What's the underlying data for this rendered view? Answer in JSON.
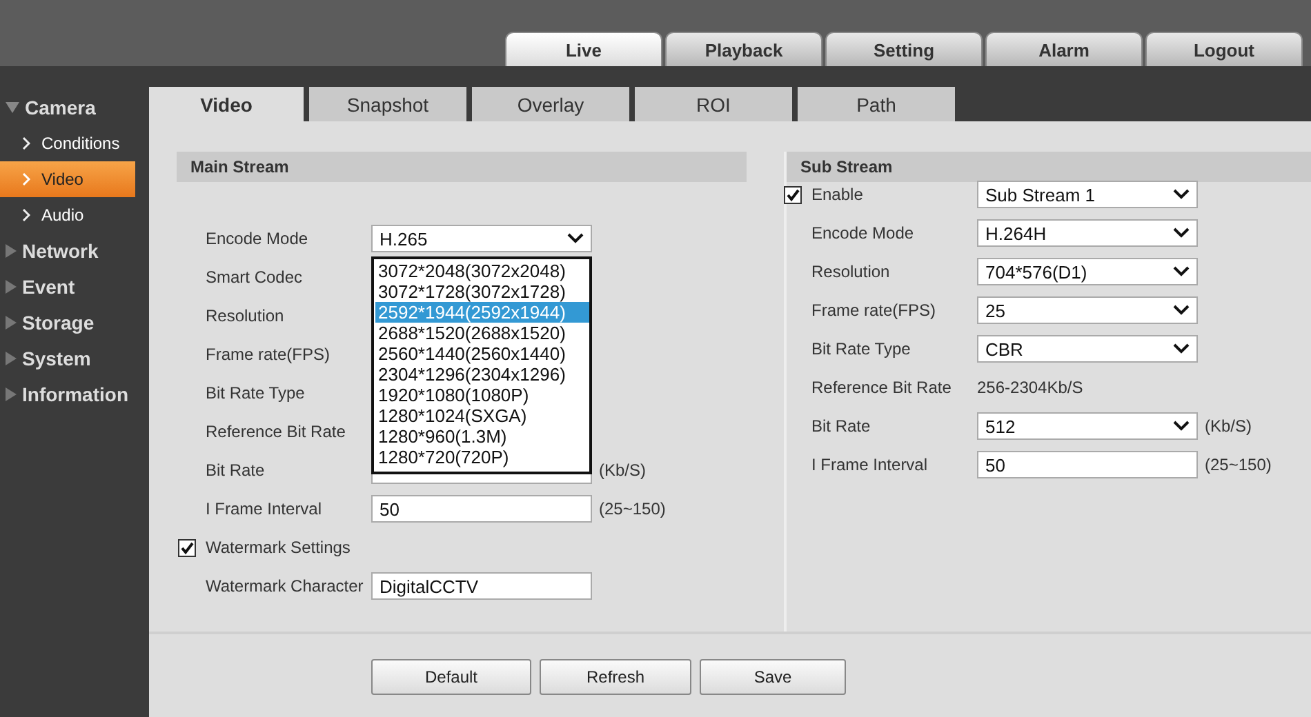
{
  "top_menu": [
    {
      "label": "Live",
      "selected": true
    },
    {
      "label": "Playback",
      "selected": false
    },
    {
      "label": "Setting",
      "selected": false
    },
    {
      "label": "Alarm",
      "selected": false
    },
    {
      "label": "Logout",
      "selected": false
    }
  ],
  "sidebar": {
    "items": [
      {
        "label": "Camera",
        "expanded": true,
        "children": [
          {
            "label": "Conditions",
            "selected": false
          },
          {
            "label": "Video",
            "selected": true
          },
          {
            "label": "Audio",
            "selected": false
          }
        ]
      },
      {
        "label": "Network",
        "expanded": false
      },
      {
        "label": "Event",
        "expanded": false
      },
      {
        "label": "Storage",
        "expanded": false
      },
      {
        "label": "System",
        "expanded": false
      },
      {
        "label": "Information",
        "expanded": false
      }
    ]
  },
  "tabs": [
    {
      "label": "Video",
      "selected": true
    },
    {
      "label": "Snapshot",
      "selected": false
    },
    {
      "label": "Overlay",
      "selected": false
    },
    {
      "label": "ROI",
      "selected": false
    },
    {
      "label": "Path",
      "selected": false
    }
  ],
  "main_stream": {
    "title": "Main Stream",
    "rows": [
      {
        "kind": "select",
        "label": "Encode Mode",
        "value": "H.265"
      },
      {
        "kind": "label",
        "label": "Smart Codec"
      },
      {
        "kind": "label",
        "label": "Resolution"
      },
      {
        "kind": "label",
        "label": "Frame rate(FPS)"
      },
      {
        "kind": "label",
        "label": "Bit Rate Type"
      },
      {
        "kind": "label",
        "label": "Reference Bit Rate"
      },
      {
        "kind": "select",
        "label": "Bit Rate",
        "unit": "(Kb/S)"
      },
      {
        "kind": "text",
        "label": "I Frame Interval",
        "value": "50",
        "unit": "(25~150)"
      },
      {
        "kind": "checkbox",
        "label": "Watermark Settings",
        "checked": true
      },
      {
        "kind": "text",
        "label": "Watermark Character",
        "value": "DigitalCCTV"
      }
    ],
    "open_dropdown": {
      "options": [
        {
          "label": "3072*2048(3072x2048)",
          "selected": false
        },
        {
          "label": "3072*1728(3072x1728)",
          "selected": false
        },
        {
          "label": "2592*1944(2592x1944)",
          "selected": true
        },
        {
          "label": "2688*1520(2688x1520)",
          "selected": false
        },
        {
          "label": "2560*1440(2560x1440)",
          "selected": false
        },
        {
          "label": "2304*1296(2304x1296)",
          "selected": false
        },
        {
          "label": "1920*1080(1080P)",
          "selected": false
        },
        {
          "label": "1280*1024(SXGA)",
          "selected": false
        },
        {
          "label": "1280*960(1.3M)",
          "selected": false
        },
        {
          "label": "1280*720(720P)",
          "selected": false
        }
      ]
    }
  },
  "sub_stream": {
    "title": "Sub Stream",
    "rows": [
      {
        "kind": "checkbox-select",
        "label": "Enable",
        "checked": true,
        "value": "Sub Stream 1"
      },
      {
        "kind": "select",
        "label": "Encode Mode",
        "value": "H.264H"
      },
      {
        "kind": "select",
        "label": "Resolution",
        "value": "704*576(D1)"
      },
      {
        "kind": "select",
        "label": "Frame rate(FPS)",
        "value": "25"
      },
      {
        "kind": "select",
        "label": "Bit Rate Type",
        "value": "CBR"
      },
      {
        "kind": "static",
        "label": "Reference Bit Rate",
        "value": "256-2304Kb/S"
      },
      {
        "kind": "select",
        "label": "Bit Rate",
        "value": "512",
        "unit": "(Kb/S)"
      },
      {
        "kind": "text",
        "label": "I Frame Interval",
        "value": "50",
        "unit": "(25~150)"
      }
    ]
  },
  "buttons": [
    "Default",
    "Refresh",
    "Save"
  ]
}
